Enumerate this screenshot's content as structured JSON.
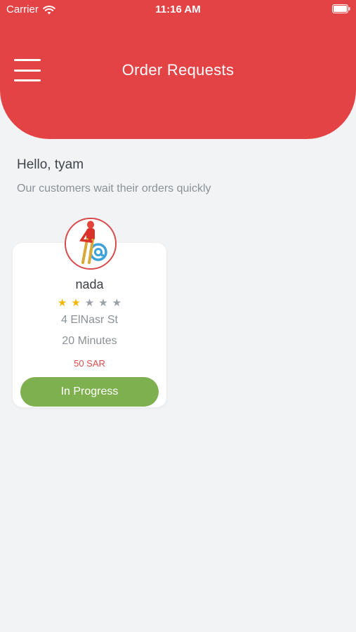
{
  "status_bar": {
    "carrier": "Carrier",
    "time": "11:16 AM"
  },
  "header": {
    "title": "Order Requests",
    "menu_icon": "hamburger-menu-icon"
  },
  "greeting": "Hello, tyam",
  "subtitle": "Our customers wait their orders quickly",
  "orders": [
    {
      "name": "nada",
      "rating": 2,
      "rating_max": 5,
      "address": "4 ElNasr St",
      "duration": "20 Minutes",
      "price": "50 SAR",
      "status": "In Progress"
    }
  ],
  "colors": {
    "accent": "#e44346",
    "success": "#7fb04f",
    "star": "#f2b705",
    "background": "#f1f3f5"
  }
}
